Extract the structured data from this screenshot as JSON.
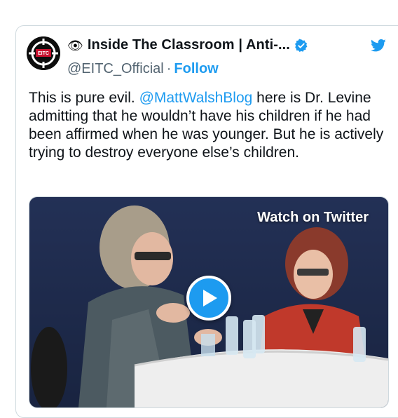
{
  "author": {
    "name_emoji": "👁",
    "display_name": "Inside The Classroom | Anti-...",
    "handle": "@EITC_Official",
    "separator": "·",
    "follow_label": "Follow",
    "avatar_text": "EITC"
  },
  "tweet": {
    "text_part1": "This is pure evil. ",
    "mention": "@MattWalshBlog",
    "text_part2": " here is Dr. Levine admitting that he wouldn’t have his children if he had been affirmed when he was younger. But he is actively trying to destroy everyone else’s children."
  },
  "media": {
    "watch_label": "Watch on Twitter"
  },
  "colors": {
    "accent": "#1d9bf0",
    "text": "#0f1419",
    "muted": "#536471"
  }
}
